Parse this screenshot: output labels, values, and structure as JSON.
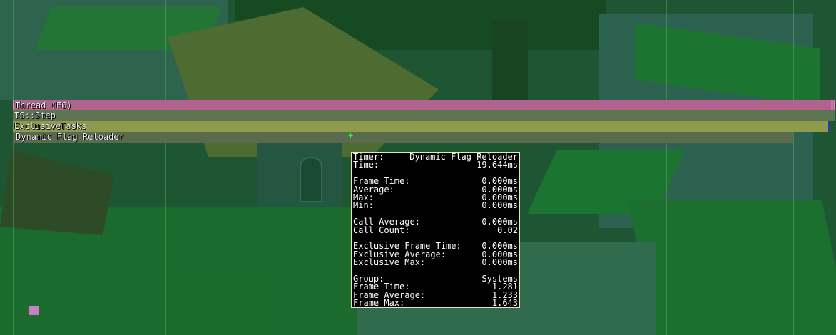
{
  "bars": {
    "thread": "Thread (FG)",
    "step": "TS::Step",
    "exclusive_tasks": "ExclusiveTasks",
    "dynamic_flag_reloader": "Dynamic Flag Reloader"
  },
  "cursor_glyph": "+",
  "tooltip": {
    "timer_label": "Timer:",
    "timer_value": "Dynamic Flag Reloader",
    "time_label": "Time:",
    "time_value": "19.644ms",
    "frame_time_label": "Frame Time:",
    "frame_time_value": "0.000ms",
    "average_label": "Average:",
    "average_value": "0.000ms",
    "max_label": "Max:",
    "max_value": "0.000ms",
    "min_label": "Min:",
    "min_value": "0.000ms",
    "call_average_label": "Call Average:",
    "call_average_value": "0.000ms",
    "call_count_label": "Call Count:",
    "call_count_value": "0.02",
    "excl_frame_time_label": "Exclusive Frame Time:",
    "excl_frame_time_value": "0.000ms",
    "excl_average_label": "Exclusive Average:",
    "excl_average_value": "0.000ms",
    "excl_max_label": "Exclusive Max:",
    "excl_max_value": "0.000ms",
    "group_label": "Group:",
    "group_value": "Systems",
    "group_frame_time_label": "Frame Time:",
    "group_frame_time_value": "1.281",
    "group_frame_average_label": "Frame Average:",
    "group_frame_average_value": "1.233",
    "group_frame_max_label": "Frame Max:",
    "group_frame_max_value": "1.643"
  },
  "colors": {
    "thread_bar": "#b2628f",
    "step_bar": "#5d7550",
    "exclusive_bar": "#8e9a4e",
    "dfr_bar": "#5a6a4c",
    "tooltip_border": "#e6e6b0"
  }
}
